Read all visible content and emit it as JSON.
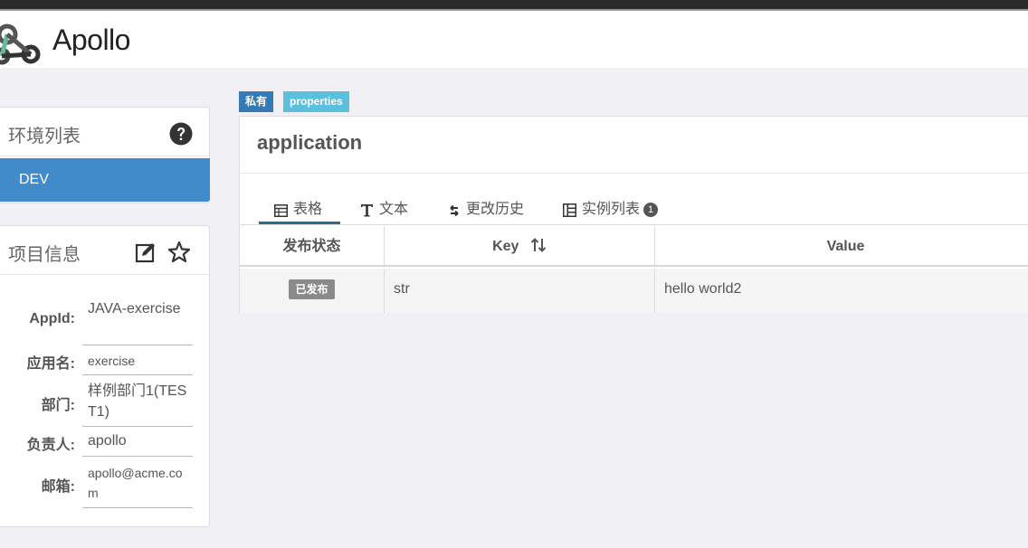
{
  "app": {
    "brand": "Apollo"
  },
  "env_panel": {
    "title": "环境列表",
    "items": [
      {
        "label": "DEV",
        "selected": true
      }
    ]
  },
  "info_panel": {
    "title": "项目信息",
    "rows": [
      {
        "label": "AppId:",
        "value": "JAVA-exercise"
      },
      {
        "label": "应用名:",
        "value": "exercise"
      },
      {
        "label": "部门:",
        "value": "样例部门1(TEST1)"
      },
      {
        "label": "负责人:",
        "value": "apollo"
      },
      {
        "label": "邮箱:",
        "value": "apollo@acme.com"
      }
    ]
  },
  "namespace": {
    "badges": {
      "scope": "私有",
      "format": "properties"
    },
    "title": "application",
    "tabs": [
      {
        "label": "表格",
        "icon": "table-icon",
        "active": true
      },
      {
        "label": "文本",
        "icon": "text-icon"
      },
      {
        "label": "更改历史",
        "icon": "history-icon"
      },
      {
        "label": "实例列表",
        "icon": "instances-icon",
        "count": "1"
      }
    ],
    "table": {
      "headers": {
        "status": "发布状态",
        "key": "Key",
        "value": "Value"
      },
      "rows": [
        {
          "status": "已发布",
          "key": "str",
          "value": "hello world2"
        }
      ]
    }
  },
  "colors": {
    "primary": "#428bca",
    "info": "#5bc0de",
    "badge_private": "#337ab7",
    "status_published": "#8a8a8a"
  }
}
